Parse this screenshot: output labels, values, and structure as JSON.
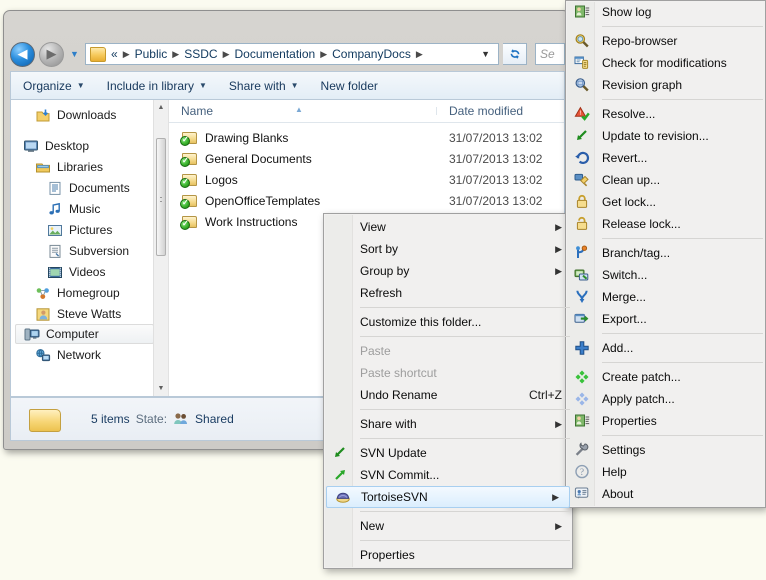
{
  "window": {
    "title": "CompanyDocs",
    "address": {
      "chevrons": "«",
      "crumbs": [
        "Public",
        "SSDC",
        "Documentation",
        "CompanyDocs"
      ],
      "separator": "▶",
      "dropdown_caret": "▼",
      "refresh_icon": "refresh-icon",
      "back_icon": "←",
      "forward_icon": "→",
      "recent_caret": "▼"
    },
    "search": {
      "value": "Se",
      "placeholder": "Search CompanyDocs"
    },
    "commandbar": [
      {
        "label": "Organize",
        "caret": "▼"
      },
      {
        "label": "Include in library",
        "caret": "▼"
      },
      {
        "label": "Share with",
        "caret": "▼"
      },
      {
        "label": "New folder",
        "caret": ""
      }
    ]
  },
  "navpane": {
    "items": [
      {
        "label": "Downloads",
        "icon": "downloads-icon",
        "indent": 1,
        "selected": false
      },
      {
        "label": "Desktop",
        "icon": "desktop-icon",
        "indent": 0,
        "selected": false
      },
      {
        "label": "Libraries",
        "icon": "libraries-icon",
        "indent": 1,
        "selected": false
      },
      {
        "label": "Documents",
        "icon": "documents-icon",
        "indent": 2,
        "selected": false
      },
      {
        "label": "Music",
        "icon": "music-icon",
        "indent": 2,
        "selected": false
      },
      {
        "label": "Pictures",
        "icon": "pictures-icon",
        "indent": 2,
        "selected": false
      },
      {
        "label": "Subversion",
        "icon": "subversion-icon",
        "indent": 2,
        "selected": false
      },
      {
        "label": "Videos",
        "icon": "videos-icon",
        "indent": 2,
        "selected": false
      },
      {
        "label": "Homegroup",
        "icon": "homegroup-icon",
        "indent": 1,
        "selected": false
      },
      {
        "label": "Steve Watts",
        "icon": "user-icon",
        "indent": 1,
        "selected": false
      },
      {
        "label": "Computer",
        "icon": "computer-icon",
        "indent": 1,
        "selected": true
      },
      {
        "label": "Network",
        "icon": "network-icon",
        "indent": 1,
        "selected": false
      }
    ],
    "scrollbar": {
      "up": "▲",
      "down": "▼"
    }
  },
  "filelist": {
    "columns": [
      "Name",
      "Date modified"
    ],
    "sort_indicator": "▲",
    "rows": [
      {
        "name": "Drawing Blanks",
        "date": "31/07/2013 13:02",
        "icon": "svn-folder-versioned-icon"
      },
      {
        "name": "General Documents",
        "date": "31/07/2013 13:02",
        "icon": "svn-folder-versioned-icon"
      },
      {
        "name": "Logos",
        "date": "31/07/2013 13:02",
        "icon": "svn-folder-versioned-icon"
      },
      {
        "name": "OpenOfficeTemplates",
        "date": "31/07/2013 13:02",
        "icon": "svn-folder-versioned-icon"
      },
      {
        "name": "Work Instructions",
        "date": "31/07/2013 13:02",
        "icon": "svn-folder-versioned-icon"
      }
    ]
  },
  "statusbar": {
    "item_count": "5 items",
    "state_label": "State:",
    "state_value": "Shared",
    "folder_icon": "folder-icon",
    "shared_icon": "shared-users-icon"
  },
  "context_menu": {
    "items": [
      {
        "label": "View",
        "arrow": "▶",
        "type": "item"
      },
      {
        "label": "Sort by",
        "arrow": "▶",
        "type": "item"
      },
      {
        "label": "Group by",
        "arrow": "▶",
        "type": "item"
      },
      {
        "label": "Refresh",
        "arrow": "",
        "type": "item"
      },
      {
        "type": "separator"
      },
      {
        "label": "Customize this folder...",
        "arrow": "",
        "type": "item"
      },
      {
        "type": "separator"
      },
      {
        "label": "Paste",
        "arrow": "",
        "type": "item",
        "disabled": true
      },
      {
        "label": "Paste shortcut",
        "arrow": "",
        "type": "item",
        "disabled": true
      },
      {
        "label": "Undo Rename",
        "arrow": "",
        "type": "item",
        "accel": "Ctrl+Z"
      },
      {
        "type": "separator"
      },
      {
        "label": "Share with",
        "arrow": "▶",
        "type": "item"
      },
      {
        "type": "separator"
      },
      {
        "label": "SVN Update",
        "arrow": "",
        "type": "item",
        "icon": "svn-update-icon"
      },
      {
        "label": "SVN Commit...",
        "arrow": "",
        "type": "item",
        "icon": "svn-commit-icon"
      },
      {
        "label": "TortoiseSVN",
        "arrow": "▶",
        "type": "item",
        "icon": "tortoise-icon",
        "highlighted": true
      },
      {
        "type": "separator"
      },
      {
        "label": "New",
        "arrow": "▶",
        "type": "item"
      },
      {
        "type": "separator"
      },
      {
        "label": "Properties",
        "arrow": "",
        "type": "item"
      }
    ]
  },
  "tortoise_submenu": {
    "items": [
      {
        "label": "Show log",
        "icon": "show-log-icon"
      },
      {
        "type": "separator"
      },
      {
        "label": "Repo-browser",
        "icon": "repo-browser-icon"
      },
      {
        "label": "Check for modifications",
        "icon": "check-modifications-icon"
      },
      {
        "label": "Revision graph",
        "icon": "revision-graph-icon"
      },
      {
        "type": "separator"
      },
      {
        "label": "Resolve...",
        "icon": "resolve-icon"
      },
      {
        "label": "Update to revision...",
        "icon": "update-to-revision-icon"
      },
      {
        "label": "Revert...",
        "icon": "revert-icon"
      },
      {
        "label": "Clean up...",
        "icon": "cleanup-icon"
      },
      {
        "label": "Get lock...",
        "icon": "get-lock-icon"
      },
      {
        "label": "Release lock...",
        "icon": "release-lock-icon"
      },
      {
        "type": "separator"
      },
      {
        "label": "Branch/tag...",
        "icon": "branch-tag-icon"
      },
      {
        "label": "Switch...",
        "icon": "switch-icon"
      },
      {
        "label": "Merge...",
        "icon": "merge-icon"
      },
      {
        "label": "Export...",
        "icon": "export-icon"
      },
      {
        "type": "separator"
      },
      {
        "label": "Add...",
        "icon": "add-icon"
      },
      {
        "type": "separator"
      },
      {
        "label": "Create patch...",
        "icon": "create-patch-icon"
      },
      {
        "label": "Apply patch...",
        "icon": "apply-patch-icon"
      },
      {
        "label": "Properties",
        "icon": "properties-icon"
      },
      {
        "type": "separator"
      },
      {
        "label": "Settings",
        "icon": "settings-icon"
      },
      {
        "label": "Help",
        "icon": "help-icon"
      },
      {
        "label": "About",
        "icon": "about-icon"
      }
    ]
  },
  "colors": {
    "accent": "#2a8ede",
    "menu_bg": "#f1f0ef",
    "highlight": "#dbeefd",
    "svn_green": "#3cb52e"
  }
}
